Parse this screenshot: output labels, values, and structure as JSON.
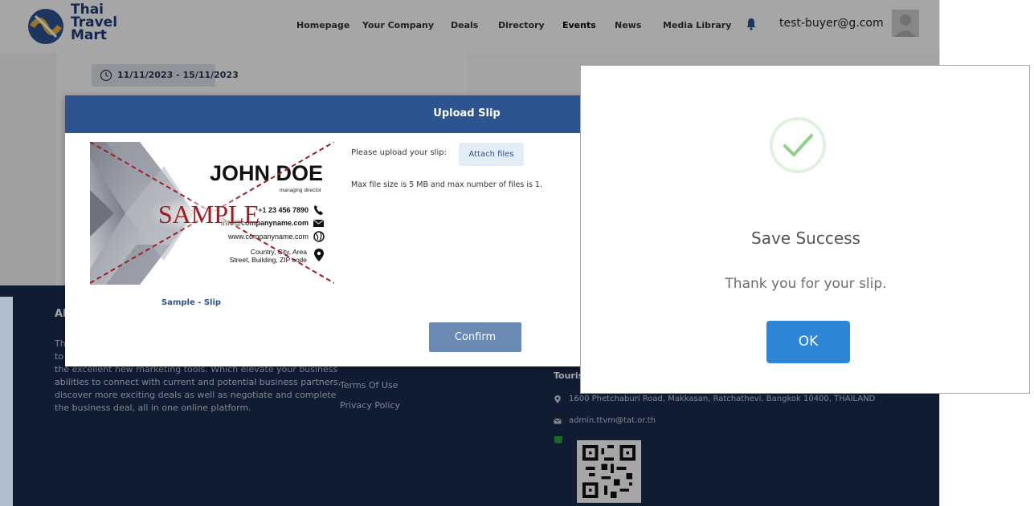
{
  "brand": {
    "line1": "Thai",
    "line2": "Travel",
    "line3": "Mart"
  },
  "nav": {
    "items": [
      {
        "label": "Homepage"
      },
      {
        "label": "Your Company"
      },
      {
        "label": "Deals"
      },
      {
        "label": "Directory"
      },
      {
        "label": "Events"
      },
      {
        "label": "News"
      },
      {
        "label": "Media Library"
      }
    ],
    "user_email": "test-buyer@g.com"
  },
  "event": {
    "date_range": "11/11/2023 - 15/11/2023"
  },
  "footer": {
    "about_title": "Ab",
    "about_lines": [
      "Th",
      "to",
      "the excellent new marketing tools. Which elevate your business",
      "abilities to connect with current and potential business partners,",
      "discover more exciting deals as well as negotiate and complete",
      "the business deal, all in one online platform."
    ],
    "links": [
      "Terms Of Use",
      "Privacy Policy"
    ],
    "org": "Touris",
    "address": "1600 Phetchaburi Road, Makkasan, Ratchathevi, Bangkok 10400, THAILAND",
    "email": "admin.ttvm@tat.or.th"
  },
  "upload_modal": {
    "title": "Upload Slip",
    "sample": {
      "name": "JOHN DOE",
      "role": "managing director",
      "watermark": "SAMPLE",
      "phone": "+1 23 456 7890",
      "email": "info@companyname.com",
      "web": "www.companyname.com",
      "address1": "Country, City, Area",
      "address2": "Street, Building, ZIP code"
    },
    "sample_caption": "Sample - Slip",
    "upload_label": "Please upload your slip:",
    "attach_label": "Attach files",
    "limit_text": "Max file size is 5 MB and max number of files is 1.",
    "confirm_label": "Confirm"
  },
  "success_dialog": {
    "title": "Save Success",
    "message": "Thank you for your slip.",
    "ok_label": "OK"
  },
  "colors": {
    "brand_blue": "#2b5491",
    "footer_bg": "#172b4d",
    "success_green": "#8fd08a",
    "ok_blue": "#2f86d8"
  }
}
